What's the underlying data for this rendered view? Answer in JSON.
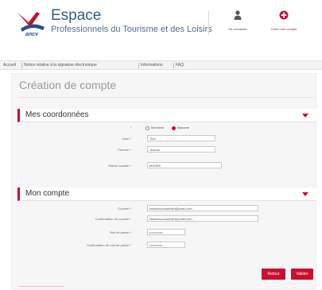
{
  "brand": {
    "title": "Espace",
    "subtitle": "Professionnels du Tourisme et des Loisirs",
    "logo_icon": "ancv-logo-icon",
    "logo_text": "ancv",
    "accent": "#c8102e"
  },
  "header": {
    "login_label": "Se connecter",
    "login_icon": "user-icon",
    "create_label": "Créer mon compte",
    "create_icon": "plus-circle-icon"
  },
  "nav": {
    "items": [
      {
        "label": "Accueil"
      },
      {
        "label": "Notice relative à la signature électronique"
      },
      {
        "label": "Informations"
      },
      {
        "label": "FAQ"
      }
    ]
  },
  "page": {
    "title": "Création de compte"
  },
  "coordonnees": {
    "title": "Mes coordonnées",
    "civility_label": "*",
    "civility_options": [
      "Monsieur",
      "Madame"
    ],
    "civility_selected": "Madame",
    "nom_label": "Nom *",
    "nom_value": "Toot",
    "prenom_label": "Prénom *",
    "prenom_value": "Jeanne",
    "raison_label": "Raison sociale *",
    "raison_value": "MUSEE"
  },
  "compte": {
    "title": "Mon compte",
    "courriel_label": "Courriel *",
    "courriel_value": "lindaesuccosbelle@ymail.com",
    "courriel_confirm_label": "Confirmation du courriel *",
    "courriel_confirm_value": "lindaesuccosbelle@ymail.com",
    "password_label": "Mot de passe *",
    "password_value": "••••••••••••",
    "password_confirm_label": "Confirmation du mot de passe *",
    "password_confirm_value": "••••••••••••"
  },
  "actions": {
    "retour": "Retour",
    "valider": "Valider"
  }
}
